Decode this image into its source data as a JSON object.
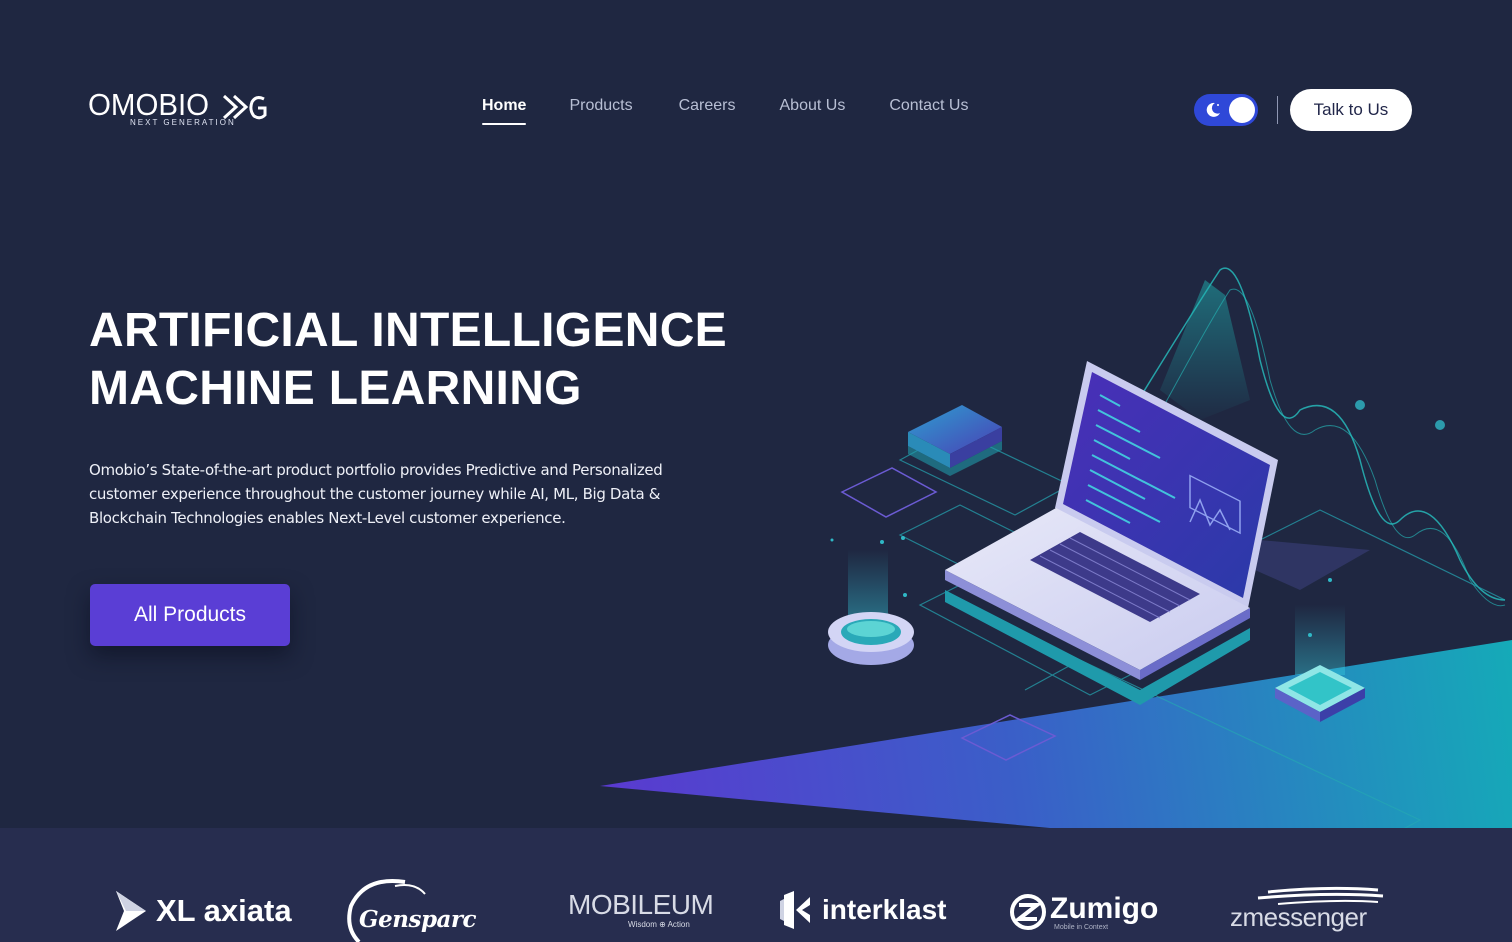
{
  "brand": {
    "name": "OMOBIO",
    "tagline": "NEXT GENERATION"
  },
  "nav": {
    "items": [
      "Home",
      "Products",
      "Careers",
      "About Us",
      "Contact Us"
    ],
    "active": "Home"
  },
  "header": {
    "theme_toggle": {
      "state": "dark",
      "icon": "moon-icon"
    },
    "cta_label": "Talk to Us"
  },
  "hero": {
    "title_line1": "ARTIFICIAL INTELLIGENCE",
    "title_line2": "MACHINE LEARNING",
    "description": "Omobio’s State-of-the-art product portfolio provides Predictive and Personalized customer experience throughout the customer journey while AI, ML, Big Data & Blockchain Technologies enables Next-Level customer experience.",
    "button_label": "All Products",
    "illustration": "isometric-laptop-illustration"
  },
  "partners": {
    "xl": "XL axiata",
    "gensparc": "Gensparc",
    "mobileum": "MOBILEUM",
    "mobileum_sub": "Wisdom ⊕ Action",
    "interklast": "interklast",
    "zumigo": "Zumigo",
    "zumigo_sub": "Mobile in Context",
    "zmessenger": "zmessenger"
  },
  "colors": {
    "background": "#1f2741",
    "partners_band": "#272d4f",
    "accent_purple": "#5a3ed5",
    "toggle_blue": "#2f48d8",
    "teal": "#17a7b8"
  }
}
